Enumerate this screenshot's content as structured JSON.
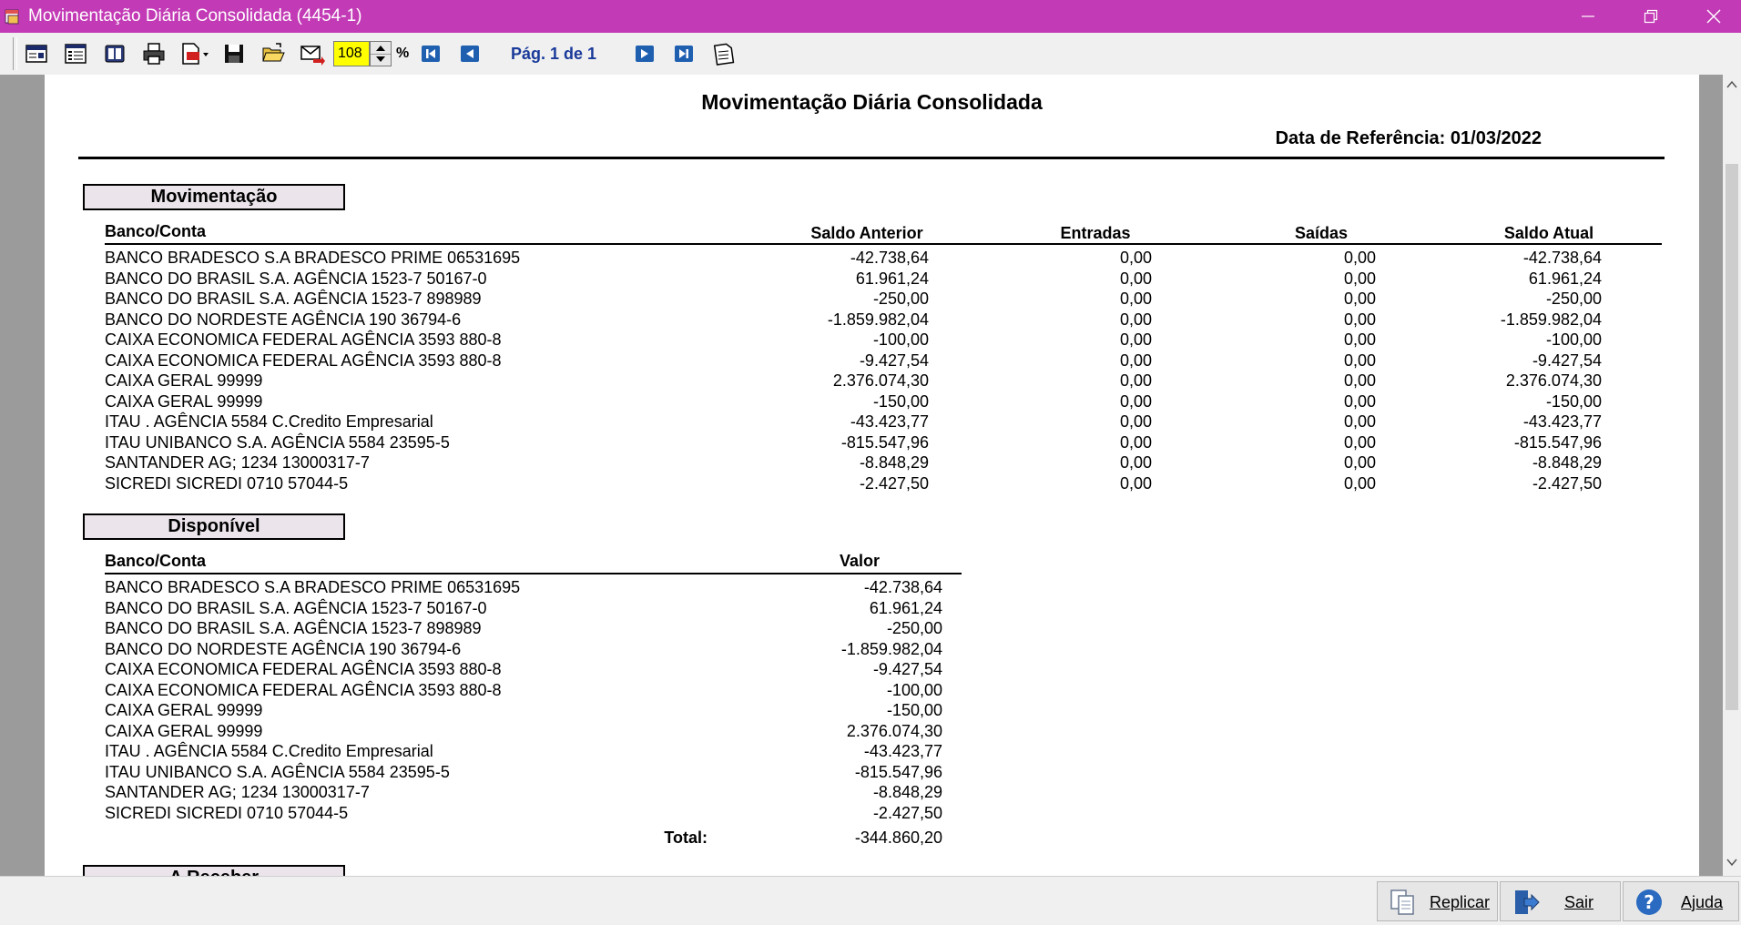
{
  "window": {
    "title": "Movimentação Diária Consolidada (4454-1)"
  },
  "toolbar": {
    "zoom_value": "108",
    "zoom_unit": "%",
    "page_label": "Pág. 1 de 1"
  },
  "report": {
    "title": "Movimentação Diária Consolidada",
    "reference": "Data de Referência: 01/03/2022",
    "movimentacao": {
      "section_label": "Movimentação",
      "headers": {
        "account": "Banco/Conta",
        "prev": "Saldo Anterior",
        "in": "Entradas",
        "out": "Saídas",
        "curr": "Saldo Atual"
      },
      "rows": [
        {
          "account": "BANCO BRADESCO S.A BRADESCO PRIME 06531695",
          "prev": "-42.738,64",
          "in": "0,00",
          "out": "0,00",
          "curr": "-42.738,64"
        },
        {
          "account": "BANCO DO BRASIL S.A. AGÊNCIA 1523-7 50167-0",
          "prev": "61.961,24",
          "in": "0,00",
          "out": "0,00",
          "curr": "61.961,24"
        },
        {
          "account": "BANCO DO BRASIL S.A. AGÊNCIA 1523-7 898989",
          "prev": "-250,00",
          "in": "0,00",
          "out": "0,00",
          "curr": "-250,00"
        },
        {
          "account": "BANCO DO NORDESTE AGÊNCIA 190 36794-6",
          "prev": "-1.859.982,04",
          "in": "0,00",
          "out": "0,00",
          "curr": "-1.859.982,04"
        },
        {
          "account": "CAIXA ECONOMICA FEDERAL AGÊNCIA 3593 880-8",
          "prev": "-100,00",
          "in": "0,00",
          "out": "0,00",
          "curr": "-100,00"
        },
        {
          "account": "CAIXA ECONOMICA FEDERAL AGÊNCIA 3593 880-8",
          "prev": "-9.427,54",
          "in": "0,00",
          "out": "0,00",
          "curr": "-9.427,54"
        },
        {
          "account": "CAIXA GERAL 99999",
          "prev": "2.376.074,30",
          "in": "0,00",
          "out": "0,00",
          "curr": "2.376.074,30"
        },
        {
          "account": "CAIXA GERAL 99999",
          "prev": "-150,00",
          "in": "0,00",
          "out": "0,00",
          "curr": "-150,00"
        },
        {
          "account": "ITAU . AGÊNCIA 5584 C.Credito Empresarial",
          "prev": "-43.423,77",
          "in": "0,00",
          "out": "0,00",
          "curr": "-43.423,77"
        },
        {
          "account": "ITAU UNIBANCO S.A. AGÊNCIA 5584 23595-5",
          "prev": "-815.547,96",
          "in": "0,00",
          "out": "0,00",
          "curr": "-815.547,96"
        },
        {
          "account": "SANTANDER AG; 1234 13000317-7",
          "prev": "-8.848,29",
          "in": "0,00",
          "out": "0,00",
          "curr": "-8.848,29"
        },
        {
          "account": "SICREDI SICREDI 0710 57044-5",
          "prev": "-2.427,50",
          "in": "0,00",
          "out": "0,00",
          "curr": "-2.427,50"
        }
      ]
    },
    "disponivel": {
      "section_label": "Disponível",
      "headers": {
        "account": "Banco/Conta",
        "value": "Valor"
      },
      "rows": [
        {
          "account": "BANCO BRADESCO S.A BRADESCO PRIME 06531695",
          "value": "-42.738,64"
        },
        {
          "account": "BANCO DO BRASIL S.A. AGÊNCIA 1523-7 50167-0",
          "value": "61.961,24"
        },
        {
          "account": "BANCO DO BRASIL S.A. AGÊNCIA 1523-7 898989",
          "value": "-250,00"
        },
        {
          "account": "BANCO DO NORDESTE AGÊNCIA 190 36794-6",
          "value": "-1.859.982,04"
        },
        {
          "account": "CAIXA ECONOMICA FEDERAL AGÊNCIA 3593 880-8",
          "value": "-9.427,54"
        },
        {
          "account": "CAIXA ECONOMICA FEDERAL AGÊNCIA 3593 880-8",
          "value": "-100,00"
        },
        {
          "account": "CAIXA GERAL 99999",
          "value": "-150,00"
        },
        {
          "account": "CAIXA GERAL 99999",
          "value": "2.376.074,30"
        },
        {
          "account": "ITAU . AGÊNCIA 5584 C.Credito Empresarial",
          "value": "-43.423,77"
        },
        {
          "account": "ITAU UNIBANCO S.A. AGÊNCIA 5584 23595-5",
          "value": "-815.547,96"
        },
        {
          "account": "SANTANDER AG; 1234 13000317-7",
          "value": "-8.848,29"
        },
        {
          "account": "SICREDI SICREDI 0710 57044-5",
          "value": "-2.427,50"
        }
      ],
      "total_label": "Total:",
      "total_value": "-344.860,20"
    },
    "next_section_label": "A Receber"
  },
  "buttons": {
    "replicar": "Replicar",
    "sair": "Sair",
    "ajuda": "Ajuda"
  }
}
